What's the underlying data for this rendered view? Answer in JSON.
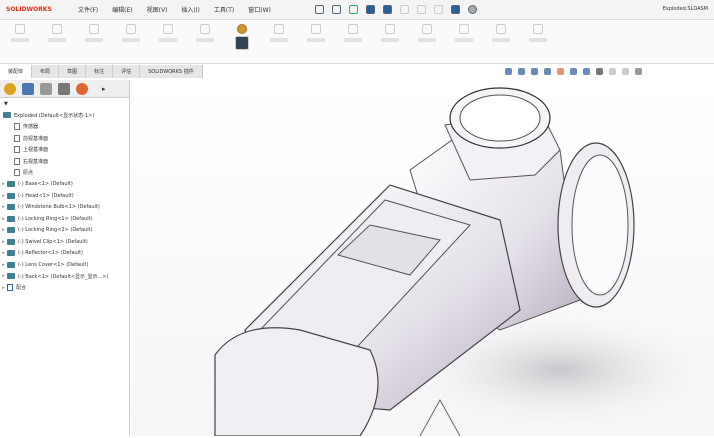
{
  "app": {
    "logo": "SOLIDWORKS",
    "title": "Exploded.SLDASM"
  },
  "menu": [
    "文件(F)",
    "编辑(E)",
    "视图(V)",
    "插入(I)",
    "工具(T)",
    "窗口(W)"
  ],
  "tabs": [
    "装配体",
    "布局",
    "草图",
    "标注",
    "评估",
    "SOLIDWORKS 插件"
  ],
  "tree": {
    "root": "Exploded (Default<显示状态-1>)",
    "items": [
      {
        "label": "传感器",
        "type": "folder"
      },
      {
        "label": "前视基准面",
        "type": "plane"
      },
      {
        "label": "上视基准面",
        "type": "plane"
      },
      {
        "label": "右视基准面",
        "type": "plane"
      },
      {
        "label": "原点",
        "type": "origin"
      },
      {
        "label": "(-) Base<1> (Default)",
        "type": "part"
      },
      {
        "label": "(-) Head<1> (Default)",
        "type": "part"
      },
      {
        "label": "(-) Windstone Bulb<1> (Default)",
        "type": "part"
      },
      {
        "label": "(-) Locking Ring<1> (Default)",
        "type": "part"
      },
      {
        "label": "(-) Locking Ring<2> (Default)",
        "type": "part"
      },
      {
        "label": "(-) Swivel Clip<1> (Default)",
        "type": "part"
      },
      {
        "label": "(-) Reflector<1> (Default)",
        "type": "part"
      },
      {
        "label": "(-) Lens Cover<1> (Default)",
        "type": "part"
      },
      {
        "label": "(-) Back<1> (Default<显示_显示...>)",
        "type": "part"
      },
      {
        "label": "配合",
        "type": "mates"
      }
    ]
  }
}
